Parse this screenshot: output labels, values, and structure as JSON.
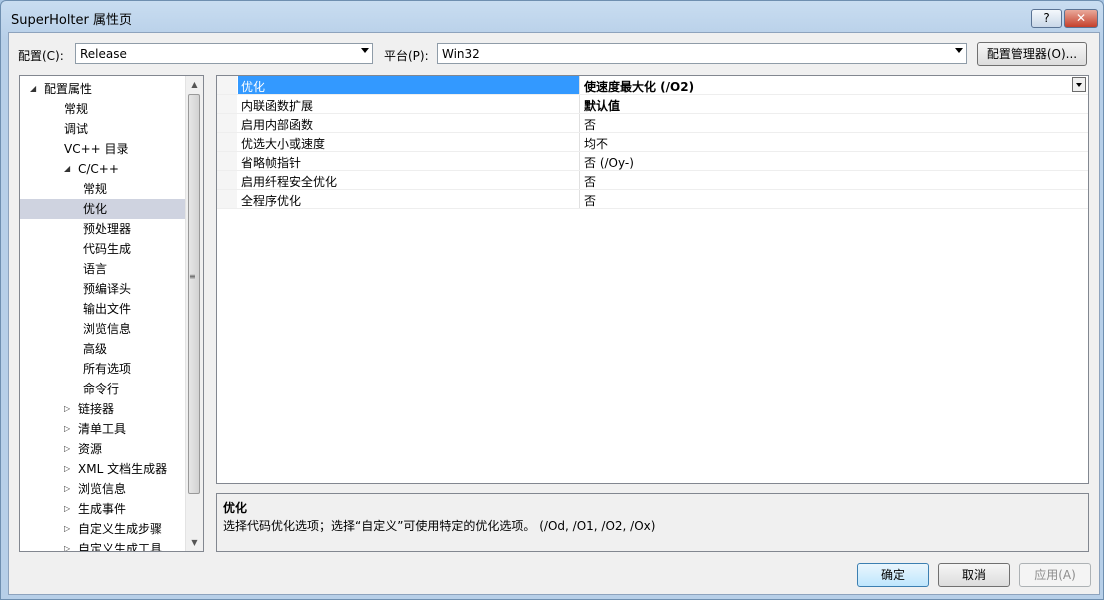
{
  "window": {
    "title": "SuperHolter 属性页",
    "help": "?",
    "close": "✕"
  },
  "config": {
    "label": "配置(C):",
    "value": "Release"
  },
  "platform": {
    "label": "平台(P):",
    "value": "Win32"
  },
  "config_manager": "配置管理器(O)...",
  "tree": [
    {
      "label": "配置属性",
      "level": 0,
      "twisty": "◢"
    },
    {
      "label": "常规",
      "level": 1
    },
    {
      "label": "调试",
      "level": 1
    },
    {
      "label": "VC++ 目录",
      "level": 1
    },
    {
      "label": "C/C++",
      "level": 1,
      "twisty": "◢"
    },
    {
      "label": "常规",
      "level": 2
    },
    {
      "label": "优化",
      "level": 2,
      "selected": true
    },
    {
      "label": "预处理器",
      "level": 2
    },
    {
      "label": "代码生成",
      "level": 2
    },
    {
      "label": "语言",
      "level": 2
    },
    {
      "label": "预编译头",
      "level": 2
    },
    {
      "label": "输出文件",
      "level": 2
    },
    {
      "label": "浏览信息",
      "level": 2
    },
    {
      "label": "高级",
      "level": 2
    },
    {
      "label": "所有选项",
      "level": 2
    },
    {
      "label": "命令行",
      "level": 2
    },
    {
      "label": "链接器",
      "level": 1,
      "twisty": "▷"
    },
    {
      "label": "清单工具",
      "level": 1,
      "twisty": "▷"
    },
    {
      "label": "资源",
      "level": 1,
      "twisty": "▷"
    },
    {
      "label": "XML 文档生成器",
      "level": 1,
      "twisty": "▷"
    },
    {
      "label": "浏览信息",
      "level": 1,
      "twisty": "▷"
    },
    {
      "label": "生成事件",
      "level": 1,
      "twisty": "▷"
    },
    {
      "label": "自定义生成步骤",
      "level": 1,
      "twisty": "▷"
    },
    {
      "label": "自定义生成工具",
      "level": 1,
      "twisty": "▷"
    }
  ],
  "properties": [
    {
      "name": "优化",
      "value": "使速度最大化 (/O2)",
      "selected": true,
      "bold": true
    },
    {
      "name": "内联函数扩展",
      "value": "默认值",
      "bold": true
    },
    {
      "name": "启用内部函数",
      "value": "否"
    },
    {
      "name": "优选大小或速度",
      "value": "均不"
    },
    {
      "name": "省略帧指针",
      "value": "否 (/Oy-)"
    },
    {
      "name": "启用纤程安全优化",
      "value": "否"
    },
    {
      "name": "全程序优化",
      "value": "否"
    }
  ],
  "description": {
    "title": "优化",
    "text": "选择代码优化选项；选择“自定义”可使用特定的优化选项。      (/Od, /O1, /O2, /Ox)"
  },
  "buttons": {
    "ok": "确定",
    "cancel": "取消",
    "apply": "应用(A)"
  },
  "scrollbar": {
    "up": "▲",
    "down": "▼",
    "grip": "≡"
  }
}
